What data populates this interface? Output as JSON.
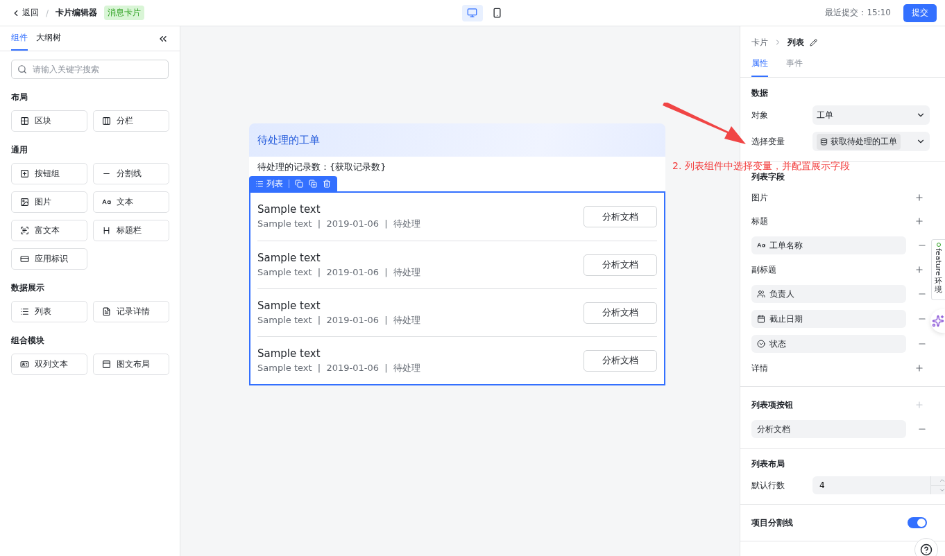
{
  "topbar": {
    "back": "返回",
    "separator": "/",
    "title": "卡片编辑器",
    "badge": "消息卡片",
    "devices": [
      {
        "kind": "desktop",
        "selected": true
      },
      {
        "kind": "mobile",
        "selected": false
      }
    ],
    "last_submit": "最近提交：15:10",
    "submit": "提交"
  },
  "left_panel": {
    "tabs": [
      {
        "label": "组件",
        "selected": true
      },
      {
        "label": "大纲树",
        "selected": false
      }
    ],
    "search": {
      "placeholder": "请输入关键字搜索"
    },
    "sections": [
      {
        "title": "布局",
        "items": [
          "区块",
          "分栏"
        ]
      },
      {
        "title": "通用",
        "items": [
          "按钮组",
          "分割线",
          "图片",
          "文本",
          "富文本",
          "标题栏",
          "应用标识"
        ]
      },
      {
        "title": "数据展示",
        "items": [
          "列表",
          "记录详情"
        ]
      },
      {
        "title": "组合模块",
        "items": [
          "双列文本",
          "图文布局"
        ]
      }
    ]
  },
  "canvas": {
    "card_title": "待处理的工单",
    "record_text": "待处理的记录数：{获取记录数}",
    "toolbar": {
      "label": "列表"
    },
    "rows": [
      {
        "title": "Sample text",
        "subtitle": "Sample text  |  2019-01-06  |  待处理",
        "button": "分析文档"
      },
      {
        "title": "Sample text",
        "subtitle": "Sample text  |  2019-01-06  |  待处理",
        "button": "分析文档"
      },
      {
        "title": "Sample text",
        "subtitle": "Sample text  |  2019-01-06  |  待处理",
        "button": "分析文档"
      },
      {
        "title": "Sample text",
        "subtitle": "Sample text  |  2019-01-06  |  待处理",
        "button": "分析文档"
      }
    ]
  },
  "annotation": "2. 列表组件中选择变量，并配置展示字段",
  "right_panel": {
    "breadcrumb": {
      "parent": "卡片",
      "current": "列表"
    },
    "tabs": [
      {
        "label": "属性",
        "selected": true
      },
      {
        "label": "事件",
        "selected": false
      }
    ],
    "data": {
      "title": "数据",
      "object_label": "对象",
      "object_value": "工单",
      "variable_label": "选择变量",
      "variable_value": "获取待处理的工单"
    },
    "list_fields": {
      "title": "列表字段",
      "groups": [
        {
          "label": "图片",
          "add_disabled": false
        },
        {
          "label": "标题",
          "add_disabled": false,
          "items": [
            "工单名称"
          ]
        },
        {
          "label": "副标题",
          "add_disabled": false,
          "items": [
            "负责人",
            "截止日期",
            "状态"
          ]
        },
        {
          "label": "详情",
          "add_disabled": false
        }
      ]
    },
    "buttons": {
      "title": "列表项按钮",
      "add_disabled": true,
      "items": [
        "分析文档"
      ]
    },
    "layout": {
      "title": "列表布局",
      "rows_label": "默认行数",
      "rows_value": "4"
    },
    "divider": {
      "label": "项目分割线",
      "on": true
    },
    "feature_tab": {
      "label": "feature",
      "env": "环境"
    }
  }
}
